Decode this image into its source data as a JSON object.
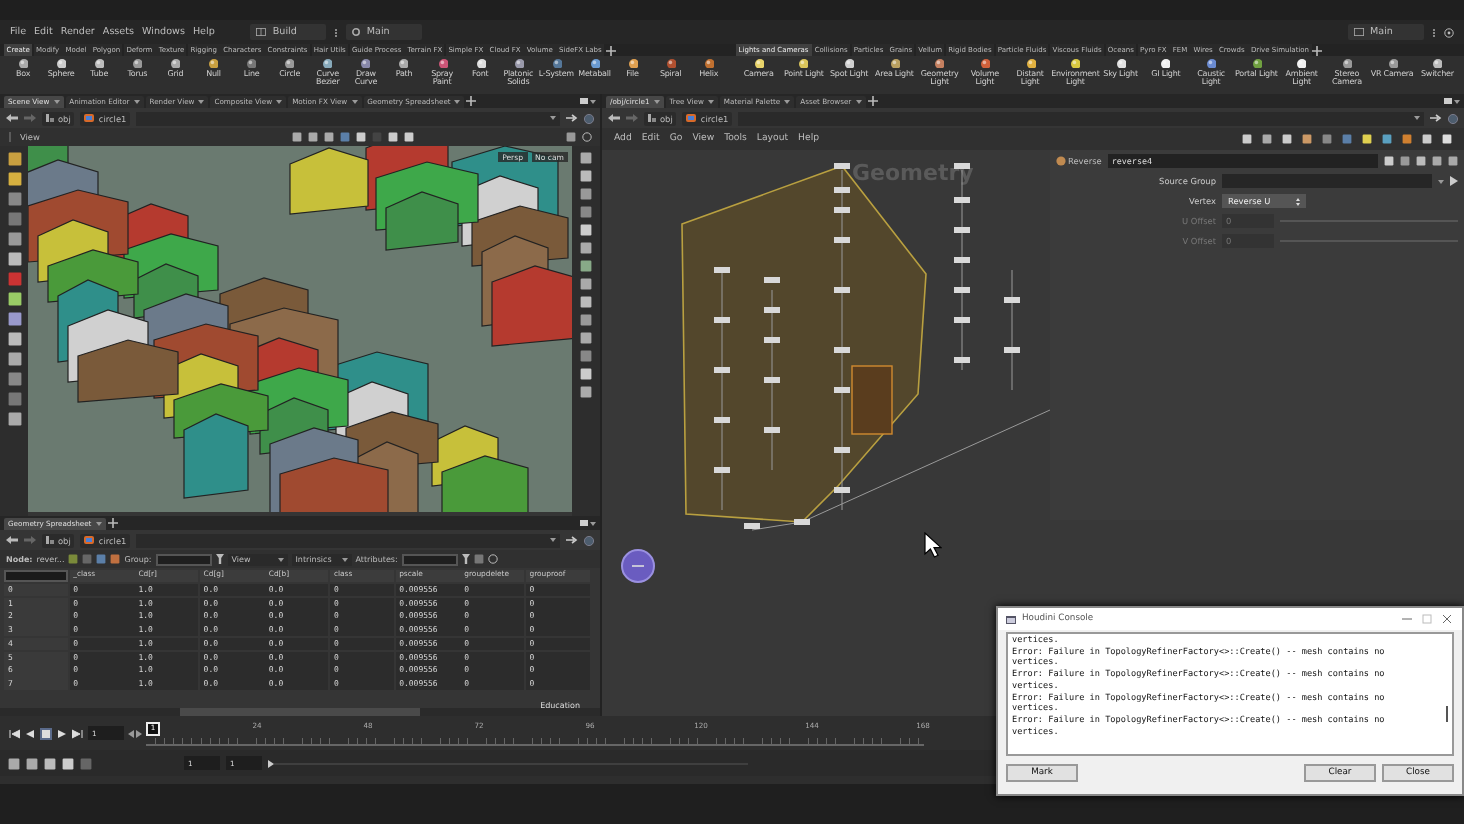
{
  "menu_bar": {
    "items": [
      "File",
      "Edit",
      "Render",
      "Assets",
      "Windows",
      "Help"
    ],
    "desktop": "Build",
    "layout": "Main",
    "right_layout": "Main"
  },
  "shelves": [
    {
      "tabs": [
        {
          "label": "Create",
          "selected": true
        },
        {
          "label": "Modify",
          "selected": false
        },
        {
          "label": "Model",
          "selected": false
        },
        {
          "label": "Polygon",
          "selected": false
        },
        {
          "label": "Deform",
          "selected": false
        },
        {
          "label": "Texture",
          "selected": false
        },
        {
          "label": "Rigging",
          "selected": false
        },
        {
          "label": "Characters",
          "selected": false
        },
        {
          "label": "Constraints",
          "selected": false
        },
        {
          "label": "Hair Utils",
          "selected": false
        },
        {
          "label": "Guide Process",
          "selected": false
        },
        {
          "label": "Terrain FX",
          "selected": false
        },
        {
          "label": "Simple FX",
          "selected": false
        },
        {
          "label": "Cloud FX",
          "selected": false
        },
        {
          "label": "Volume",
          "selected": false
        },
        {
          "label": "SideFX Labs",
          "selected": false
        }
      ],
      "tools": [
        "Box",
        "Sphere",
        "Tube",
        "Torus",
        "Grid",
        "Null",
        "Line",
        "Circle",
        "Curve Bezier",
        "Draw Curve",
        "Path",
        "Spray Paint",
        "Font",
        "Platonic Solids",
        "L-System",
        "Metaball",
        "File",
        "Spiral",
        "Helix"
      ]
    },
    {
      "tabs": [
        {
          "label": "Lights and Cameras",
          "selected": true
        },
        {
          "label": "Collisions",
          "selected": false
        },
        {
          "label": "Particles",
          "selected": false
        },
        {
          "label": "Grains",
          "selected": false
        },
        {
          "label": "Vellum",
          "selected": false
        },
        {
          "label": "Rigid Bodies",
          "selected": false
        },
        {
          "label": "Particle Fluids",
          "selected": false
        },
        {
          "label": "Viscous Fluids",
          "selected": false
        },
        {
          "label": "Oceans",
          "selected": false
        },
        {
          "label": "Pyro FX",
          "selected": false
        },
        {
          "label": "FEM",
          "selected": false
        },
        {
          "label": "Wires",
          "selected": false
        },
        {
          "label": "Crowds",
          "selected": false
        },
        {
          "label": "Drive Simulation",
          "selected": false
        }
      ],
      "tools": [
        "Camera",
        "Point Light",
        "Spot Light",
        "Area Light",
        "Geometry Light",
        "Volume Light",
        "Distant Light",
        "Environment Light",
        "Sky Light",
        "GI Light",
        "Caustic Light",
        "Portal Light",
        "Ambient Light",
        "Stereo Camera",
        "VR Camera",
        "Switcher"
      ]
    }
  ],
  "scene_pane": {
    "tabs": [
      {
        "label": "Scene View",
        "selected": true
      },
      {
        "label": "Animation Editor",
        "selected": false
      },
      {
        "label": "Render View",
        "selected": false
      },
      {
        "label": "Composite View",
        "selected": false
      },
      {
        "label": "Motion FX View",
        "selected": false
      },
      {
        "label": "Geometry Spreadsheet",
        "selected": false
      }
    ],
    "path": [
      "obj",
      "circle1"
    ],
    "view_label": "View",
    "camera": "Persp",
    "camera_menu": "No cam"
  },
  "spreadsheet": {
    "tabs": [
      {
        "label": "Geometry Spreadsheet",
        "selected": true
      }
    ],
    "path": [
      "obj",
      "circle1"
    ],
    "node_label": "Node:",
    "node": "rever...",
    "group_label": "Group:",
    "view": "View",
    "intrinsics": "Intrinsics",
    "attributes_label": "Attributes:",
    "columns": [
      "",
      "_class",
      "Cd[r]",
      "Cd[g]",
      "Cd[b]",
      "class",
      "pscale",
      "groupdelete",
      "grouproof"
    ],
    "rows": [
      [
        "0",
        "0",
        "1.0",
        "0.0",
        "0.0",
        "0",
        "0.009556",
        "0",
        "0"
      ],
      [
        "1",
        "0",
        "1.0",
        "0.0",
        "0.0",
        "0",
        "0.009556",
        "0",
        "0"
      ],
      [
        "2",
        "0",
        "1.0",
        "0.0",
        "0.0",
        "0",
        "0.009556",
        "0",
        "0"
      ],
      [
        "3",
        "0",
        "1.0",
        "0.0",
        "0.0",
        "0",
        "0.009556",
        "0",
        "0"
      ],
      [
        "4",
        "0",
        "1.0",
        "0.0",
        "0.0",
        "0",
        "0.009556",
        "0",
        "0"
      ],
      [
        "5",
        "0",
        "1.0",
        "0.0",
        "0.0",
        "0",
        "0.009556",
        "0",
        "0"
      ],
      [
        "6",
        "0",
        "1.0",
        "0.0",
        "0.0",
        "0",
        "0.009556",
        "0",
        "0"
      ],
      [
        "7",
        "0",
        "1.0",
        "0.0",
        "0.0",
        "0",
        "0.009556",
        "0",
        "0"
      ]
    ],
    "edition_label": "Education"
  },
  "network_pane": {
    "tabs": [
      {
        "label": "/obj/circle1",
        "selected": true
      },
      {
        "label": "Tree View",
        "selected": false
      },
      {
        "label": "Material Palette",
        "selected": false
      },
      {
        "label": "Asset Browser",
        "selected": false
      }
    ],
    "path": [
      "obj",
      "circle1"
    ],
    "menu": [
      "Add",
      "Edit",
      "Go",
      "View",
      "Tools",
      "Layout",
      "Help"
    ],
    "context_label": "Geometry"
  },
  "parameters": {
    "node_type": "Reverse",
    "node_name": "reverse4",
    "fields": [
      {
        "label": "Source Group",
        "kind": "text",
        "disabled": false
      },
      {
        "label": "Vertex",
        "kind": "menu",
        "value": "Reverse U",
        "disabled": false
      },
      {
        "label": "U Offset",
        "kind": "slider",
        "value": "0",
        "disabled": true
      },
      {
        "label": "V Offset",
        "kind": "slider",
        "value": "0",
        "disabled": true
      }
    ]
  },
  "timeline": {
    "frame": "1",
    "current_frame": "1",
    "ticks": [
      "24",
      "48",
      "72",
      "96",
      "120",
      "144",
      "168"
    ],
    "range_start": "1",
    "range_end": "1"
  },
  "console": {
    "title": "Houdini Console",
    "lines": [
      "vertices.",
      "Error: Failure in TopologyRefinerFactory<>::Create() -- mesh contains no",
      "vertices.",
      "Error: Failure in TopologyRefinerFactory<>::Create() -- mesh contains no",
      "vertices.",
      "Error: Failure in TopologyRefinerFactory<>::Create() -- mesh contains no",
      "vertices.",
      "Error: Failure in TopologyRefinerFactory<>::Create() -- mesh contains no",
      "vertices."
    ],
    "buttons": [
      {
        "label": "Mark",
        "kind": "left"
      },
      {
        "label": "Clear",
        "kind": "right"
      },
      {
        "label": "Close",
        "kind": "right"
      }
    ]
  }
}
